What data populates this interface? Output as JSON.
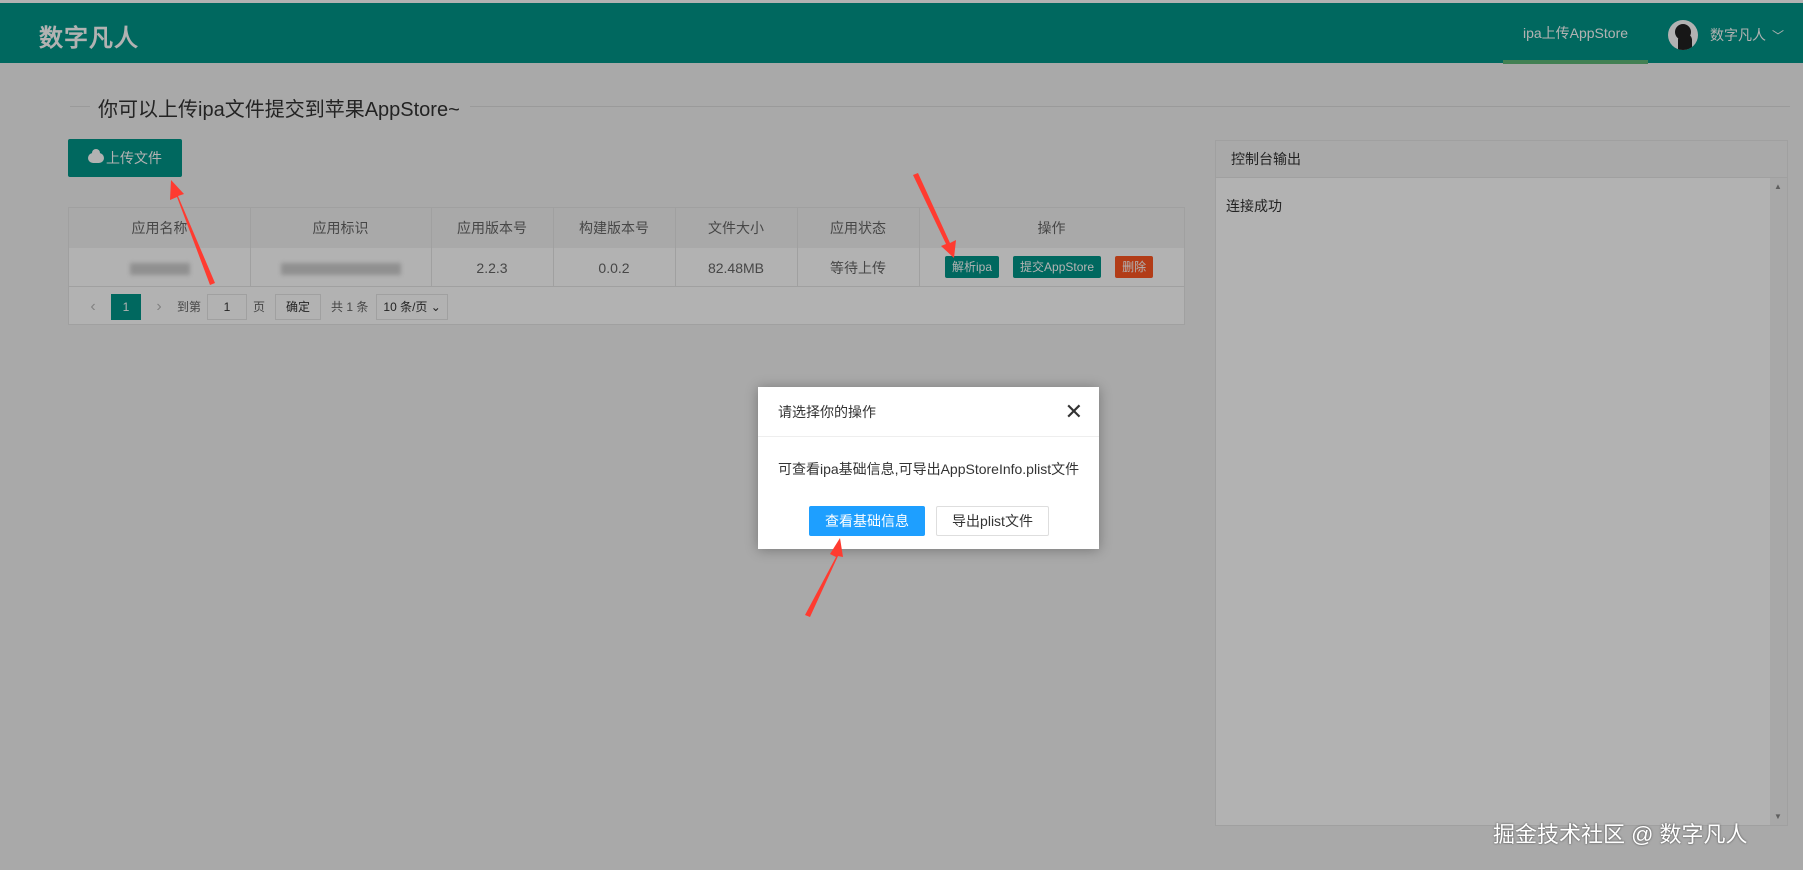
{
  "header": {
    "logo": "数字凡人",
    "nav_item": "ipa上传AppStore",
    "user_name": "数字凡人",
    "user_chevron": "﹀"
  },
  "legend": "你可以上传ipa文件提交到苹果AppStore~",
  "upload_button": "上传文件",
  "table": {
    "columns": [
      "应用名称",
      "应用标识",
      "应用版本号",
      "构建版本号",
      "文件大小",
      "应用状态",
      "操作"
    ],
    "rows": [
      {
        "version": "2.2.3",
        "build": "0.0.2",
        "size": "82.48MB",
        "status": "等待上传"
      }
    ],
    "actions": {
      "parse": "解析ipa",
      "submit": "提交AppStore",
      "delete": "删除"
    }
  },
  "pager": {
    "current": "1",
    "goto_label": "到第",
    "page_value": "1",
    "page_unit": "页",
    "confirm": "确定",
    "total": "共 1 条",
    "page_size": "10 条/页"
  },
  "console": {
    "title": "控制台输出",
    "output": "连接成功"
  },
  "dialog": {
    "title": "请选择你的操作",
    "close": "✕",
    "content": "可查看ipa基础信息,可导出AppStoreInfo.plist文件",
    "primary": "查看基础信息",
    "secondary": "导出plist文件"
  },
  "watermark": "掘金技术社区 @ 数字凡人",
  "colors": {
    "brand": "#009688",
    "accent_blue": "#1e9fff",
    "danger": "#ff5722",
    "annotation": "#ff3b30"
  }
}
